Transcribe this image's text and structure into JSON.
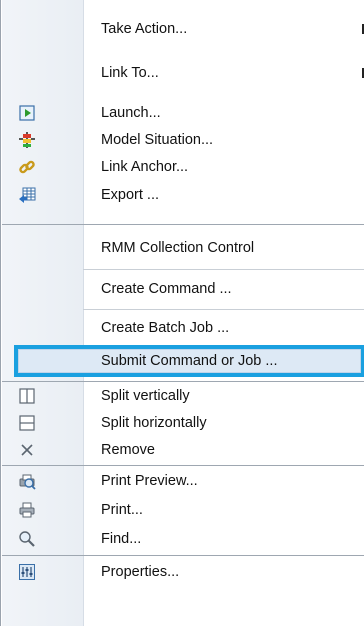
{
  "menu": {
    "items": [
      {
        "label": "Take Action...",
        "icon": "none",
        "submenu": true
      },
      {
        "label": "Link To...",
        "icon": "none",
        "submenu": true
      },
      {
        "label": "Launch...",
        "icon": "launch-icon",
        "submenu": false
      },
      {
        "label": "Model Situation...",
        "icon": "model-situation-icon",
        "submenu": false
      },
      {
        "label": "Link Anchor...",
        "icon": "link-anchor-icon",
        "submenu": false
      },
      {
        "label": "Export ...",
        "icon": "export-icon",
        "submenu": false
      },
      {
        "label": "RMM Collection Control",
        "icon": "none",
        "submenu": false
      },
      {
        "label": "Create Command ...",
        "icon": "none",
        "submenu": false
      },
      {
        "label": "Create Batch Job ...",
        "icon": "none",
        "submenu": false
      },
      {
        "label": "Submit Command or Job ...",
        "icon": "none",
        "submenu": false,
        "highlighted": true
      },
      {
        "label": "Split vertically",
        "icon": "split-vertical-icon",
        "submenu": false
      },
      {
        "label": "Split horizontally",
        "icon": "split-horizontal-icon",
        "submenu": false
      },
      {
        "label": "Remove",
        "icon": "remove-icon",
        "submenu": false
      },
      {
        "label": "Print Preview...",
        "icon": "print-preview-icon",
        "submenu": false
      },
      {
        "label": "Print...",
        "icon": "print-icon",
        "submenu": false
      },
      {
        "label": "Find...",
        "icon": "find-icon",
        "submenu": false
      },
      {
        "label": "Properties...",
        "icon": "properties-icon",
        "submenu": false
      }
    ]
  },
  "colors": {
    "highlight_border": "#1aa0e0",
    "highlight_fill": "#dde9f5",
    "gutter": "#eef2f7"
  }
}
